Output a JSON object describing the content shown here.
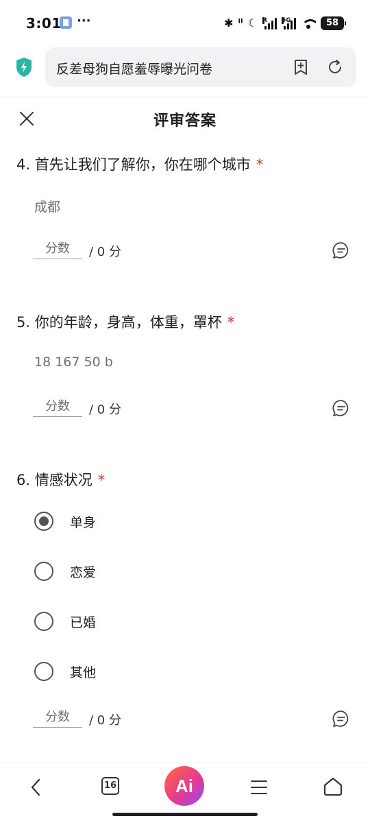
{
  "status_bar": {
    "time": "3:01",
    "more": "···",
    "battery": "58"
  },
  "browser": {
    "url_title": "反差母狗自愿羞辱曝光问卷"
  },
  "page": {
    "title": "评审答案"
  },
  "questions": [
    {
      "number_title": "4. 首先让我们了解你，你在哪个城市",
      "required_mark": "*",
      "answer": "成都",
      "score_placeholder": "分数",
      "score_total": "/ 0 分"
    },
    {
      "number_title": "5. 你的年龄，身高，体重，罩杯",
      "required_mark": "*",
      "answer": "18 167 50 b",
      "score_placeholder": "分数",
      "score_total": "/ 0 分"
    },
    {
      "number_title": "6. 情感状况",
      "required_mark": "*",
      "options": [
        {
          "label": "单身",
          "selected": true
        },
        {
          "label": "恋爱",
          "selected": false
        },
        {
          "label": "已婚",
          "selected": false
        },
        {
          "label": "其他",
          "selected": false
        }
      ],
      "score_placeholder": "分数",
      "score_total": "/ 0 分"
    }
  ],
  "bottom_nav": {
    "tab_count": "16",
    "ai_label": "Ai"
  },
  "colors": {
    "required": "#c0392b",
    "shield": "#2bb6a3"
  }
}
